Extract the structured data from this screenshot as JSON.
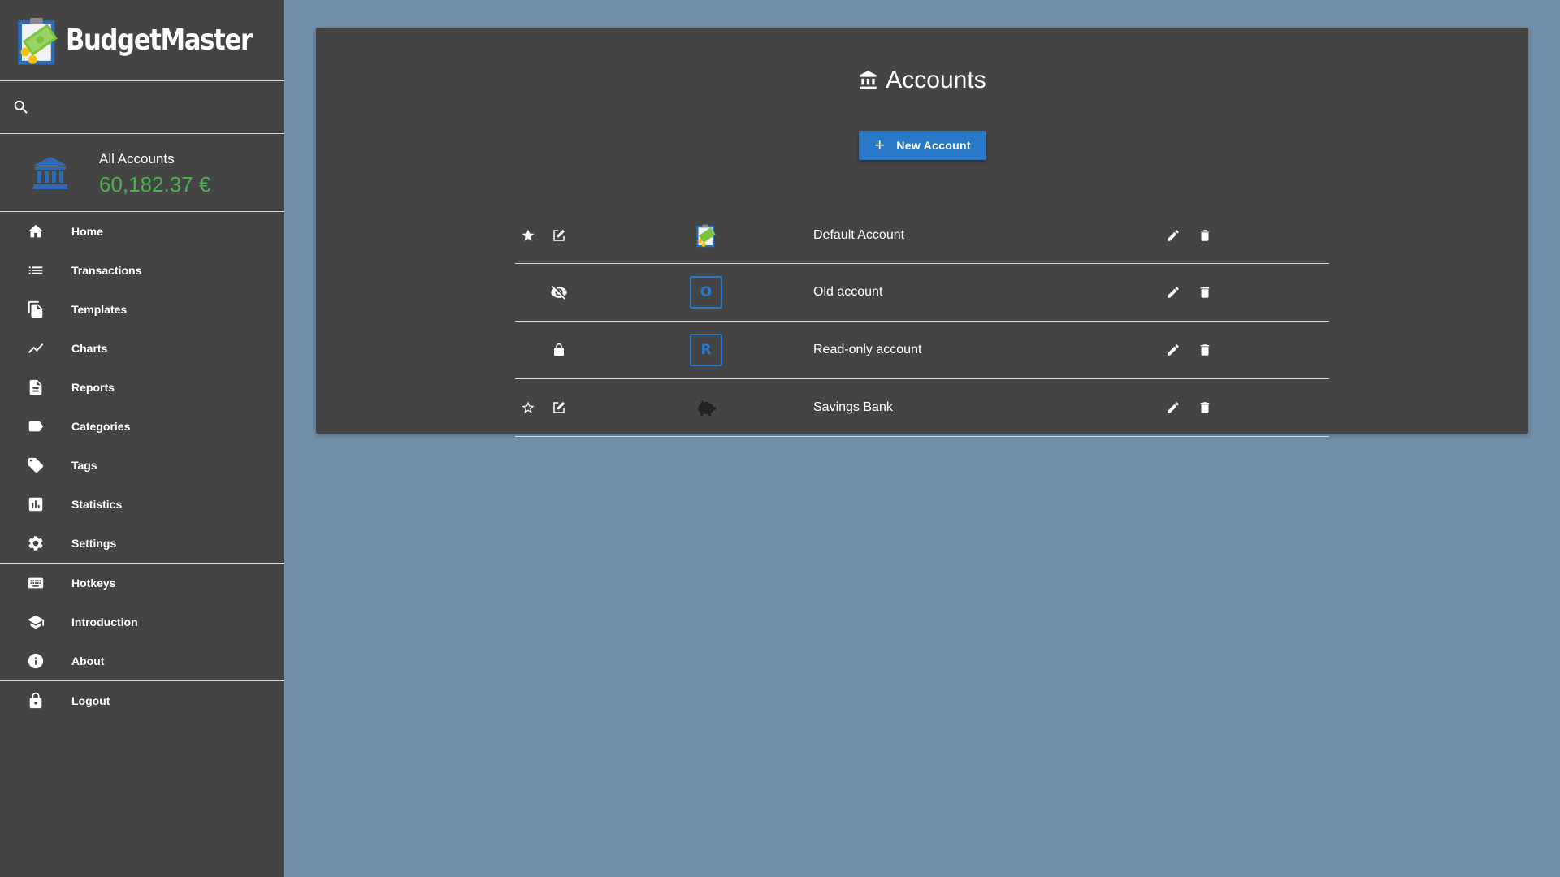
{
  "app": {
    "name": "BudgetMaster"
  },
  "search": {
    "placeholder": ""
  },
  "account_selector": {
    "name": "All Accounts",
    "balance": "60,182.37 €",
    "balance_color": "#4caf50"
  },
  "nav": {
    "home": "Home",
    "transactions": "Transactions",
    "templates": "Templates",
    "charts": "Charts",
    "reports": "Reports",
    "categories": "Categories",
    "tags": "Tags",
    "statistics": "Statistics",
    "settings": "Settings",
    "hotkeys": "Hotkeys",
    "introduction": "Introduction",
    "about": "About",
    "logout": "Logout"
  },
  "page": {
    "title": "Accounts",
    "title_icon": "bank-icon",
    "new_button_label": "New Account",
    "accent_color": "#2979c8"
  },
  "accounts": [
    {
      "name": "Default Account",
      "favorite": true,
      "state_icon": "edit-note-icon",
      "logo": "budgetmaster-logo-icon",
      "logo_letter": ""
    },
    {
      "name": "Old account",
      "favorite": false,
      "state_icon": "eye-off-icon",
      "logo": "letter-logo",
      "logo_letter": "O"
    },
    {
      "name": "Read-only account",
      "favorite": false,
      "state_icon": "lock-icon",
      "logo": "letter-logo",
      "logo_letter": "R"
    },
    {
      "name": "Savings Bank",
      "favorite": false,
      "state_icon": "edit-note-icon",
      "logo": "piggy-bank-icon",
      "logo_letter": ""
    }
  ]
}
